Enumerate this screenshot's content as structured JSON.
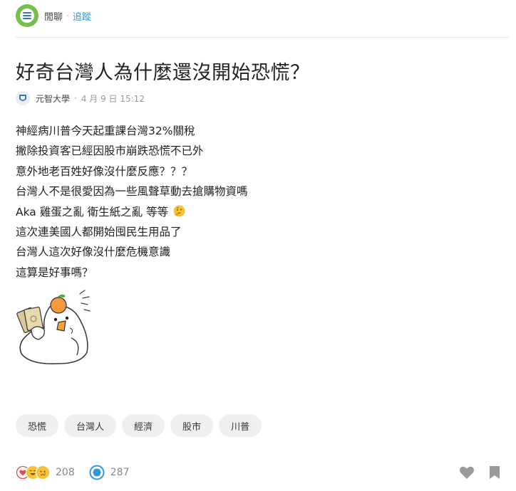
{
  "header": {
    "board_name": "閒聊",
    "separator": "·",
    "follow_label": "追蹤"
  },
  "post": {
    "title": "好奇台灣人為什麼還沒開始恐慌？",
    "author": "元智大學",
    "separator": "·",
    "time": "4 月 9 日 15:12",
    "lines": [
      "神經病川普今天起重課台灣32%關稅",
      "撇除投資客已經因股市崩跌恐慌不已外",
      "意外地老百姓好像沒什麼反應？？？",
      "台灣人不是很愛因為一些風聲草動去搶購物資嗎",
      "Aka 雞蛋之亂 衛生紙之亂 等等",
      "這次連美國人都開始囤民生用品了",
      "台灣人這次好像沒什麼危機意識",
      "這算是好事嗎？"
    ]
  },
  "tags": [
    "恐慌",
    "台灣人",
    "經濟",
    "股市",
    "川普"
  ],
  "footer": {
    "reaction_count": "208",
    "comment_count": "287",
    "colors": {
      "heart": "#e94b4b",
      "emoji": "#f7c234",
      "comment": "#3397cf",
      "icons": "#9a9a9a"
    }
  }
}
